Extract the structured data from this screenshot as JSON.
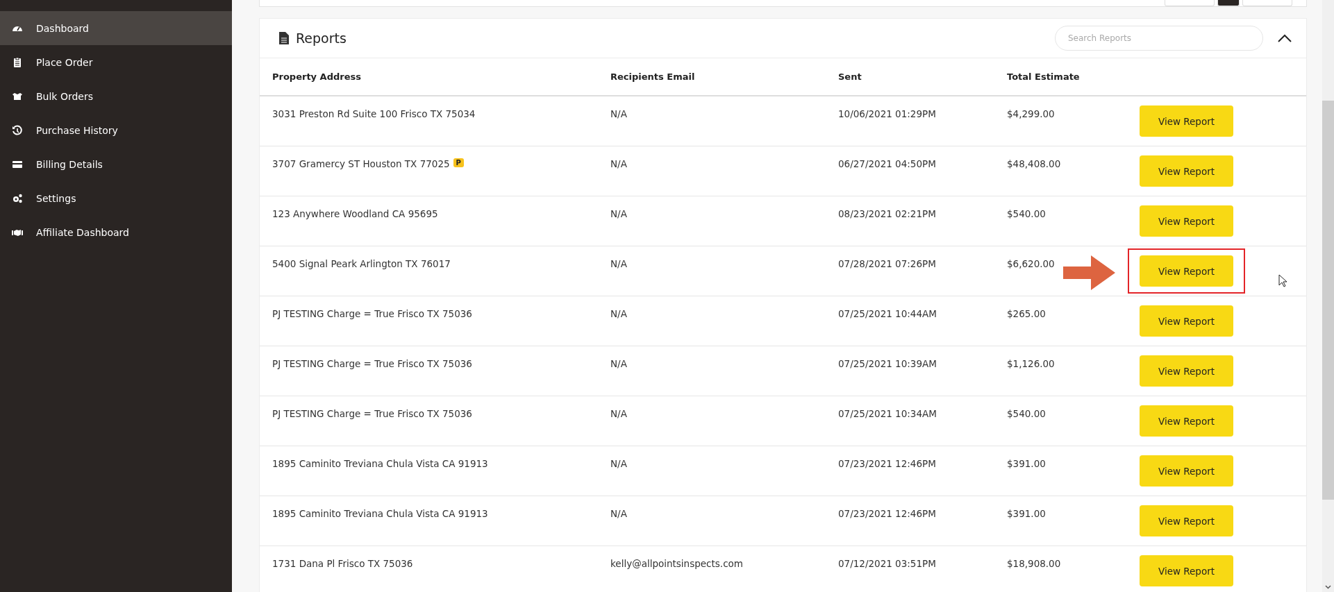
{
  "sidebar": {
    "items": [
      {
        "label": "Dashboard",
        "kind": "gauge",
        "selected": true
      },
      {
        "label": "Place Order",
        "kind": "clipboard",
        "selected": false
      },
      {
        "label": "Bulk Orders",
        "kind": "boxes",
        "selected": false
      },
      {
        "label": "Purchase History",
        "kind": "history",
        "selected": false
      },
      {
        "label": "Billing Details",
        "kind": "card",
        "selected": false
      },
      {
        "label": "Settings",
        "kind": "gears",
        "selected": false
      },
      {
        "label": "Affiliate Dashboard",
        "kind": "handshake",
        "selected": false
      }
    ]
  },
  "reports": {
    "title": "Reports",
    "search": {
      "placeholder": "Search Reports"
    },
    "expanded": true,
    "columns": [
      "Property Address",
      "Recipients Email",
      "Sent",
      "Total Estimate"
    ],
    "rows": [
      {
        "address": "3031 Preston Rd Suite 100 Frisco TX 75034",
        "badge": null,
        "email": "N/A",
        "sent": "10/06/2021 01:29PM",
        "total": "$4,299.00",
        "action": "View Report",
        "highlighted": false
      },
      {
        "address": "3707 Gramercy ST Houston TX 77025",
        "badge": "P",
        "email": "N/A",
        "sent": "06/27/2021 04:50PM",
        "total": "$48,408.00",
        "action": "View Report",
        "highlighted": false
      },
      {
        "address": "123 Anywhere Woodland CA 95695",
        "badge": null,
        "email": "N/A",
        "sent": "08/23/2021 02:21PM",
        "total": "$540.00",
        "action": "View Report",
        "highlighted": false
      },
      {
        "address": "5400 Signal Peark Arlington TX 76017",
        "badge": null,
        "email": "N/A",
        "sent": "07/28/2021 07:26PM",
        "total": "$6,620.00",
        "action": "View Report",
        "highlighted": true
      },
      {
        "address": "PJ TESTING Charge = True Frisco TX 75036",
        "badge": null,
        "email": "N/A",
        "sent": "07/25/2021 10:44AM",
        "total": "$265.00",
        "action": "View Report",
        "highlighted": false
      },
      {
        "address": "PJ TESTING Charge = True Frisco TX 75036",
        "badge": null,
        "email": "N/A",
        "sent": "07/25/2021 10:39AM",
        "total": "$1,126.00",
        "action": "View Report",
        "highlighted": false
      },
      {
        "address": "PJ TESTING Charge = True Frisco TX 75036",
        "badge": null,
        "email": "N/A",
        "sent": "07/25/2021 10:34AM",
        "total": "$540.00",
        "action": "View Report",
        "highlighted": false
      },
      {
        "address": "1895 Caminito Treviana Chula Vista CA 91913",
        "badge": null,
        "email": "N/A",
        "sent": "07/23/2021 12:46PM",
        "total": "$391.00",
        "action": "View Report",
        "highlighted": false
      },
      {
        "address": "1895 Caminito Treviana Chula Vista CA 91913",
        "badge": null,
        "email": "N/A",
        "sent": "07/23/2021 12:46PM",
        "total": "$391.00",
        "action": "View Report",
        "highlighted": false
      },
      {
        "address": "1731 Dana Pl Frisco TX 75036",
        "badge": null,
        "email": "kelly@allpointsinspects.com",
        "sent": "07/12/2021 03:51PM",
        "total": "$18,908.00",
        "action": "View Report",
        "highlighted": false
      }
    ]
  }
}
